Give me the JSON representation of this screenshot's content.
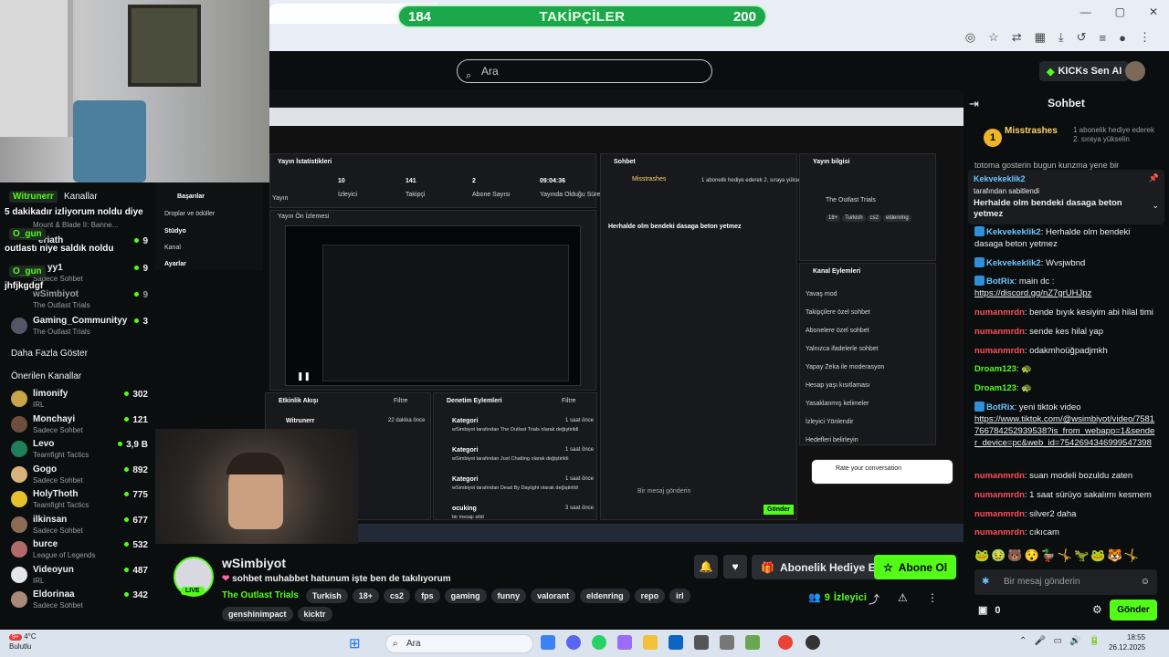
{
  "browser": {
    "followers_left": "184",
    "followers_label": "TAKİPÇİLER",
    "followers_right": "200"
  },
  "topbar": {
    "search_placeholder": "Ara",
    "ai_label": "KICKs Sen AI"
  },
  "overlay": {
    "msgs": [
      {
        "user": "Witrunerr",
        "text": "5 dakikadır izliyorum noldu diye"
      },
      {
        "user": "O_gun",
        "text": "outlastı niye saldık noldu"
      },
      {
        "user": "O_gun",
        "text": "jhfjkgdgf"
      }
    ]
  },
  "sidebar": {
    "header_channels": "Kanallar",
    "partial_channels": [
      {
        "name": "Mount & Blade II: Banne...",
        "game": ""
      },
      {
        "name": "eriath",
        "game": "",
        "viewers": "9"
      },
      {
        "name": "yy1",
        "game": "Sadece Sohbet",
        "viewers": "9"
      },
      {
        "name": "wSimbiyot",
        "game": "The Outlast Trials",
        "viewers": "9"
      },
      {
        "name": "Gaming_Communityy",
        "game": "The Outlast Trials",
        "viewers": "3"
      }
    ],
    "more_label": "Daha Fazla Göster",
    "recommended_label": "Önerilen Kanallar",
    "recommended": [
      {
        "name": "limonify",
        "game": "IRL",
        "viewers": "302",
        "color": "#c9a34a"
      },
      {
        "name": "Monchayi",
        "game": "Sadece Sohbet",
        "viewers": "121",
        "color": "#6b4e3d"
      },
      {
        "name": "Levo",
        "game": "Teamfight Tactics",
        "viewers": "3,9 B",
        "color": "#1f7f5a"
      },
      {
        "name": "Gogo",
        "game": "Sadece Sohbet",
        "viewers": "892",
        "color": "#d8b27a"
      },
      {
        "name": "HolyThoth",
        "game": "Teamfight Tactics",
        "viewers": "775",
        "color": "#e6c22a"
      },
      {
        "name": "ilkinsan",
        "game": "Sadece Sohbet",
        "viewers": "677",
        "color": "#8b6b55"
      },
      {
        "name": "burce",
        "game": "League of Legends",
        "viewers": "532",
        "color": "#b06a6a"
      },
      {
        "name": "Videoyun",
        "game": "IRL",
        "viewers": "487",
        "color": "#e5e5e5"
      },
      {
        "name": "Eldorinaa",
        "game": "Sadece Sohbet",
        "viewers": "342",
        "color": "#a88a7a"
      }
    ]
  },
  "nested": {
    "menu": [
      "Başarılar",
      "Droplar ve ödüller",
      "Stüdyo",
      "Kanal",
      "Ayarlar"
    ],
    "stats_title": "Yayın İstatistikleri",
    "stats": [
      {
        "v": "10",
        "l": "İzleyici"
      },
      {
        "v": "141",
        "l": "Takipçi"
      },
      {
        "v": "2",
        "l": "Abone Sayısı"
      },
      {
        "v": "09:04:36",
        "l": "Yayında Olduğu Süre"
      }
    ],
    "stats_first_label": "Yayın",
    "preview_label": "Yayın Ön İzlemesi",
    "activity_title": "Etkinlik Akışı",
    "activity_user": "Witrunerr",
    "activity_time": "22 dakika önce",
    "mod_title": "Denetim Eylemleri",
    "filter": "Filtre",
    "mod_items": [
      {
        "t": "Kategori",
        "d": "wSimbiyot tarafından The Outlast Trials olarak değiştirildi",
        "time": "1 saat önce"
      },
      {
        "t": "Kategori",
        "d": "wSimbiyot tarafından Just Chatting olarak değiştirildi",
        "time": "1 saat önce"
      },
      {
        "t": "Kategori",
        "d": "wSimbiyot tarafından Dead By Daylight olarak değiştirildi",
        "time": "1 saat önce"
      },
      {
        "t": "ocuking",
        "d": "bir mesajı sildi",
        "time": "3 saat önce"
      }
    ],
    "chat_title": "Sohbet",
    "stream_info_title": "Yayın bilgisi",
    "stream_info_game": "The Outlast Trials",
    "stream_info_tags": [
      "18+",
      "Turkish",
      "cs2",
      "eldenring"
    ],
    "channel_actions_title": "Kanal Eylemleri",
    "channel_actions": [
      "Yavaş mod",
      "Takipçilere özel sohbet",
      "Abonelere özel sohbet",
      "Yalnızca ifadelerle sohbet",
      "Yapay Zeka ile moderasyon",
      "Hesap yaşı kısıtlaması",
      "Yasaklanmış kelimeler",
      "İzleyici Yönlendir",
      "Hedefleri belirleyin"
    ],
    "rate_label": "Rate your conversation",
    "chat_input": "Bir mesaj gönderin",
    "send": "Gönder"
  },
  "stream": {
    "name": "wSimbiyot",
    "live": "LIVE",
    "title": "sohbet muhabbet hatunum işte ben de takılıyorum",
    "category": "The Outlast Trials",
    "tags": [
      "Turkish",
      "18+",
      "cs2",
      "fps",
      "gaming",
      "funny",
      "valorant",
      "eldenring",
      "repo",
      "irl"
    ],
    "tags2": [
      "genshinimpact",
      "kicktr"
    ],
    "gift_label": "Abonelik Hediye Et",
    "sub_label": "Abone Ol",
    "viewers_count": "9",
    "viewers_label": "İzleyici"
  },
  "chat": {
    "title": "Sohbet",
    "top_gifter": "Misstrashes",
    "top_gifter_count": "1",
    "top_gifter_note": "1 abonelik hediye ederek 2. sıraya yükselin",
    "cut_text": "totoma gosterin bugun kunzma yene bir",
    "pinned_user": "Kekvekeklik2",
    "pinned_by": "tarafından sabitlendi",
    "pinned_text": "Herhalde olm bendeki dasaga beton yetmez",
    "messages": [
      {
        "user": "Kekvekeklik2",
        "text": "Herhalde olm bendeki dasaga beton yetmez",
        "color": "#6ec6ff"
      },
      {
        "user": "Kekvekeklik2",
        "text": "Wvsjwbnd",
        "color": "#6ec6ff"
      },
      {
        "user": "BotRix",
        "text": "main dc :",
        "link": "https://discord.gg/nZ7grUHJpz",
        "color": "#6ec6ff"
      },
      {
        "user": "numanmrdn",
        "text": "bende bıyık kesiyim abi hilal timi",
        "color": "#ff4d5a"
      },
      {
        "user": "numanmrdn",
        "text": "sende kes hilal yap",
        "color": "#ff4d5a"
      },
      {
        "user": "numanmrdn",
        "text": "odakmhoüğpadjmkh",
        "color": "#ff4d5a"
      },
      {
        "user": "Droam123",
        "text": "",
        "color": "#53fc18"
      },
      {
        "user": "Droam123",
        "text": "",
        "color": "#53fc18"
      },
      {
        "user": "BotRix",
        "text": "yeni tiktok video",
        "link": "https://www.tiktok.com/@wsimbiyot/video/7581766784252939538?is_from_webapp=1&sender_device=pc&web_id=7542694346999547398",
        "color": "#6ec6ff"
      },
      {
        "user": "numanmrdn",
        "text": "suan modeli bozuldu zaten",
        "color": "#ff4d5a"
      },
      {
        "user": "numanmrdn",
        "text": "1 saat sürüyo sakalımı kesmem",
        "color": "#ff4d5a"
      },
      {
        "user": "numanmrdn",
        "text": "silver2 daha",
        "color": "#ff4d5a"
      },
      {
        "user": "numanmrdn",
        "text": "cıkıcam",
        "color": "#ff4d5a"
      }
    ],
    "input_placeholder": "Bir mesaj gönderin",
    "points": "0",
    "send_label": "Gönder"
  },
  "taskbar": {
    "weather_temp": "4°C",
    "weather_label": "Bulutlu",
    "search": "Ara",
    "time": "18:55",
    "date": "26.12.2025"
  },
  "colors": {
    "accent": "#53fc18",
    "danger": "#ff4d5a",
    "bg": "#0b0e0f"
  }
}
